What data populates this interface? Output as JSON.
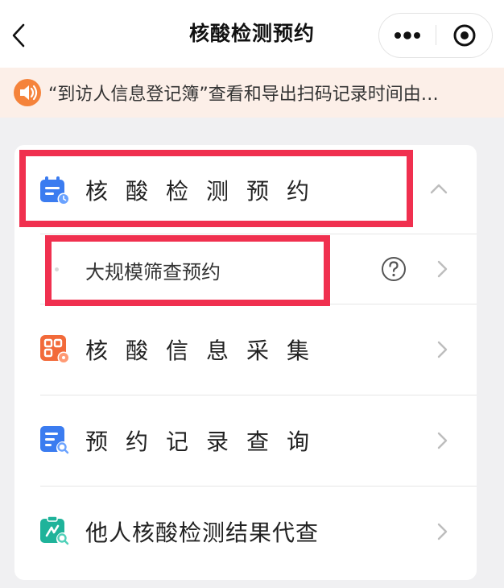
{
  "header": {
    "title": "核酸检测预约"
  },
  "notice": {
    "text": "“到访人信息登记簿”查看和导出扫码记录时间由…",
    "icon": "speaker-icon"
  },
  "menu": {
    "group": {
      "label": "核酸检测预约",
      "expanded": true,
      "icon": "calendar-icon"
    },
    "sub_items": [
      {
        "label": "大规模筛查预约",
        "help_icon": "question-circle-icon"
      }
    ],
    "items": [
      {
        "label": "核酸信息采集",
        "icon": "qr-grid-icon"
      },
      {
        "label": "预约记录查询",
        "icon": "document-search-icon"
      },
      {
        "label": "他人核酸检测结果代查",
        "icon": "clipboard-search-icon"
      }
    ]
  },
  "colors": {
    "highlight": "#f0304f",
    "notice_bg": "#fcefe8",
    "speaker": "#f5833b",
    "blue_icon": "#3b7cf0",
    "orange_icon": "#f26a3a",
    "teal_icon": "#1fb39a"
  }
}
